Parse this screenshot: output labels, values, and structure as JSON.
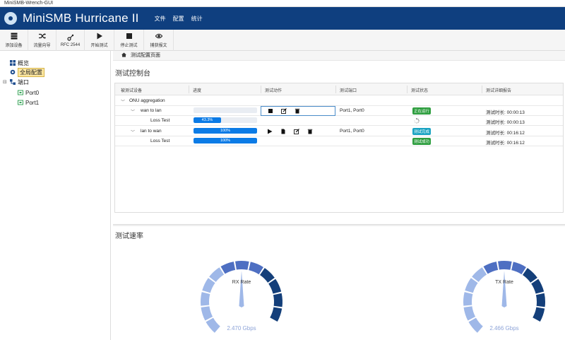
{
  "window": {
    "title": "MiniSMB-Wrench-GUI"
  },
  "app": {
    "title": "MiniSMB Hurricane II"
  },
  "menu": [
    "文件",
    "配置",
    "统计"
  ],
  "toolbar": [
    {
      "label": "添加设备",
      "icon": "server-stack-icon"
    },
    {
      "label": "流量向导",
      "icon": "shuffle-icon"
    },
    {
      "label": "RFC 2544",
      "icon": "rfc-icon"
    },
    {
      "label": "开始测试",
      "icon": "play-icon"
    },
    {
      "label": "停止测试",
      "icon": "stop-icon"
    },
    {
      "label": "捕获报文",
      "icon": "eye-icon"
    }
  ],
  "sidebar": {
    "overview": "概览",
    "global_config": "全局配置",
    "ports": "端口",
    "port0": "Port0",
    "port1": "Port1"
  },
  "breadcrumb": "测试配置页面",
  "console": {
    "title": "测试控制台",
    "columns": [
      "被测试设备",
      "进度",
      "测试动作",
      "测试端口",
      "测试状态",
      "测试详细报告"
    ],
    "group": "ONU aggregation",
    "rows": [
      {
        "name": "wan to lan",
        "progress": 0,
        "progress_text": "",
        "ports": "Port1, Port0",
        "status": "正在运行",
        "status_type": "running",
        "report": "测试时长: 00:00:13"
      },
      {
        "name": "Loss Test",
        "progress": 43.3,
        "progress_text": "43.3%",
        "ports": "",
        "status": "",
        "status_type": "spinner",
        "report": "测试时长: 00:00:13"
      },
      {
        "name": "lan to wan",
        "progress": 100,
        "progress_text": "100%",
        "ports": "Port1, Port0",
        "status": "测试完成",
        "status_type": "done",
        "report": "测试时长: 00:16:12"
      },
      {
        "name": "Loss Test",
        "progress": 100,
        "progress_text": "100%",
        "ports": "",
        "status": "测试成功",
        "status_type": "success",
        "report": "测试时长: 00:16:12"
      }
    ]
  },
  "rates": {
    "title": "测试速率",
    "rx": {
      "label": "RX Rate",
      "value": "2.470 Gbps"
    },
    "tx": {
      "label": "TX Rate",
      "value": "2.466 Gbps"
    }
  },
  "colors": {
    "header": "#0f3f7f",
    "progress": "#0b7be6",
    "running": "#2e9e3f",
    "done": "#1aa3c2",
    "gauge_light": "#9fb8e8",
    "gauge_mid": "#4e6fc2",
    "gauge_dark": "#143f7a"
  }
}
